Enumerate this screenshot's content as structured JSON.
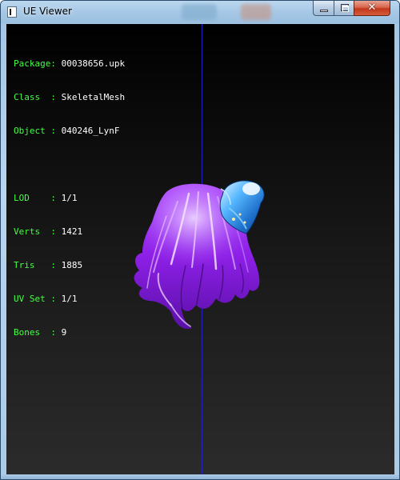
{
  "window": {
    "title": "UE Viewer",
    "controls": {
      "minimize": "minimize",
      "maximize": "maximize",
      "close": "✕"
    }
  },
  "info": {
    "rows": [
      {
        "label": "Package: ",
        "value": "00038656.upk"
      },
      {
        "label": "Class  : ",
        "value": "SkeletalMesh"
      },
      {
        "label": "Object : ",
        "value": "040246_LynF"
      }
    ],
    "stats": [
      {
        "label": "LOD    : ",
        "value": "1/1"
      },
      {
        "label": "Verts  : ",
        "value": "1421"
      },
      {
        "label": "Tris   : ",
        "value": "1885"
      },
      {
        "label": "UV Set : ",
        "value": "1/1"
      },
      {
        "label": "Bones  : ",
        "value": "9"
      }
    ]
  },
  "colors": {
    "label": "#44ff44",
    "value": "#ffffff",
    "axis": "#2020c0",
    "hair_primary": "#9b2cf0",
    "hair_highlight": "#e6c8ff",
    "accessory": "#2f8fe0"
  }
}
